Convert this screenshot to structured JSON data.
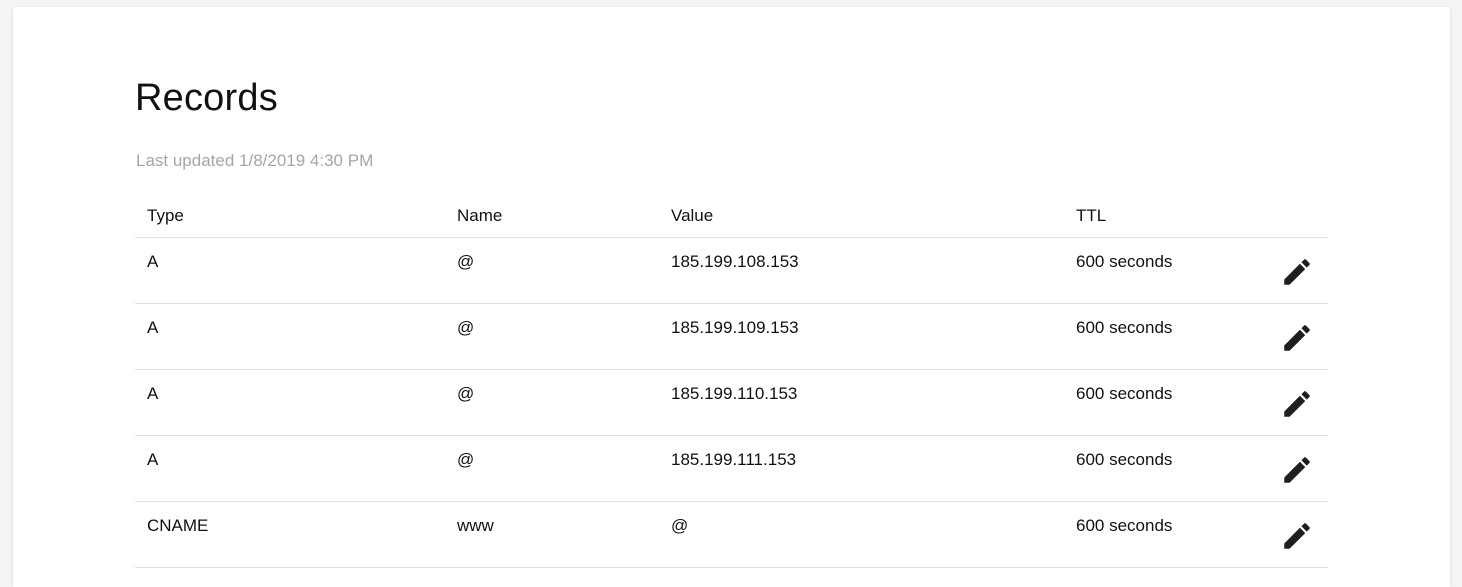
{
  "page": {
    "title": "Records",
    "last_updated": "Last updated 1/8/2019 4:30 PM"
  },
  "table": {
    "headers": {
      "type": "Type",
      "name": "Name",
      "value": "Value",
      "ttl": "TTL"
    },
    "rows": [
      {
        "type": "A",
        "name": "@",
        "value": "185.199.108.153",
        "ttl": "600 seconds",
        "action_icon": "pencil-icon"
      },
      {
        "type": "A",
        "name": "@",
        "value": "185.199.109.153",
        "ttl": "600 seconds",
        "action_icon": "pencil-icon"
      },
      {
        "type": "A",
        "name": "@",
        "value": "185.199.110.153",
        "ttl": "600 seconds",
        "action_icon": "pencil-icon"
      },
      {
        "type": "A",
        "name": "@",
        "value": "185.199.111.153",
        "ttl": "600 seconds",
        "action_icon": "pencil-icon"
      },
      {
        "type": "CNAME",
        "name": "www",
        "value": "@",
        "ttl": "600 seconds",
        "action_icon": "pencil-icon"
      }
    ]
  },
  "colors": {
    "text": "#111111",
    "muted": "#a6a6a6",
    "divider": "#e2e2e2",
    "background": "#f4f4f4",
    "card": "#ffffff"
  }
}
